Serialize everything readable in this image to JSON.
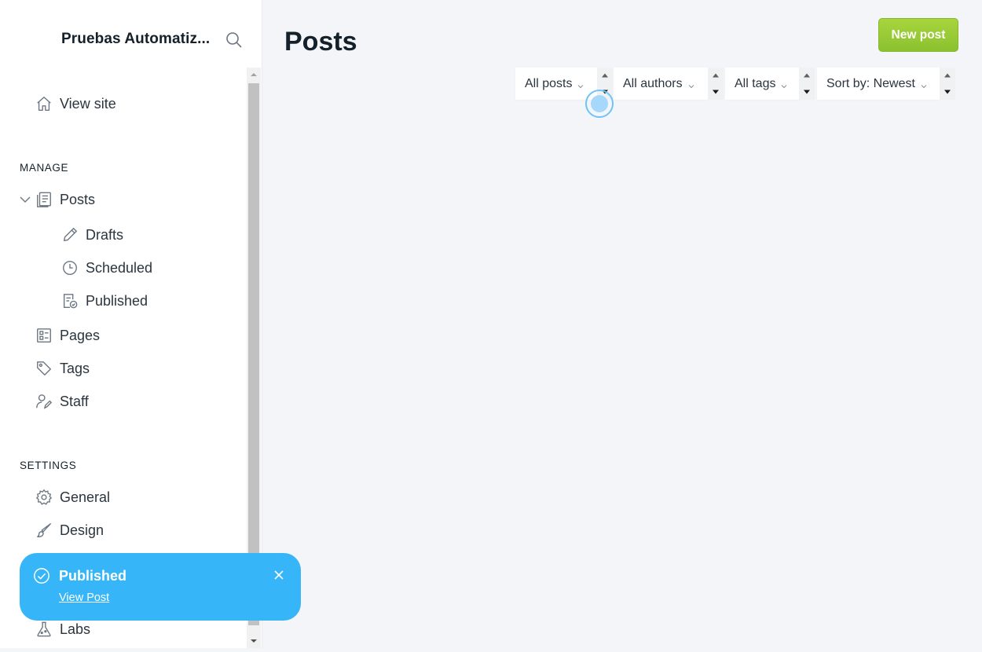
{
  "sidebar": {
    "brand": "Pruebas Automatiz...",
    "view_site": "View site",
    "manage_label": "MANAGE",
    "posts": "Posts",
    "drafts": "Drafts",
    "scheduled": "Scheduled",
    "published": "Published",
    "pages": "Pages",
    "tags": "Tags",
    "staff": "Staff",
    "settings_label": "SETTINGS",
    "general": "General",
    "design": "Design",
    "labs": "Labs"
  },
  "main": {
    "title": "Posts",
    "new_post": "New post",
    "filters": {
      "type": "All posts",
      "author": "All authors",
      "tag": "All tags",
      "sort": "Sort by: Newest"
    }
  },
  "toast": {
    "title": "Published",
    "link": "View Post"
  },
  "colors": {
    "accent_green": "#9fcd3a",
    "toast_blue": "#36b5f8"
  }
}
